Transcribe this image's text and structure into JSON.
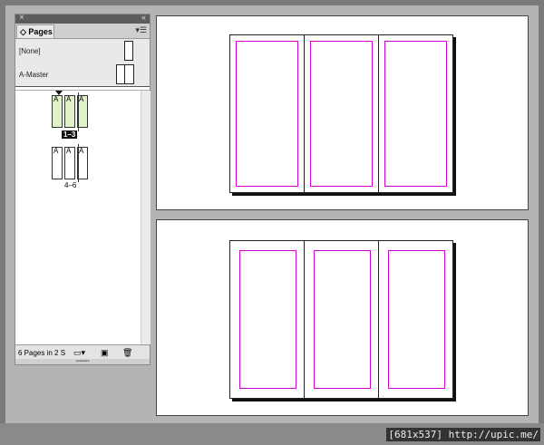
{
  "panel": {
    "close_glyph": "×",
    "collapse_glyph": "«",
    "tab_title": "Pages",
    "menu_glyph": "▾☰",
    "masters": [
      {
        "label": "[None]"
      },
      {
        "label": "A-Master"
      }
    ],
    "spreads": [
      {
        "label": "1–3",
        "pages": [
          "A",
          "A",
          "A"
        ],
        "selected": true
      },
      {
        "label": "4–6",
        "pages": [
          "A",
          "A",
          "A"
        ],
        "selected": false
      }
    ],
    "status_text": "6 Pages in 2 S",
    "status_icons": [
      "new-page-size-icon",
      "new-page-icon",
      "trash-icon"
    ]
  },
  "credit": "[681x537] http://upic.me/",
  "colors": {
    "margin_guide": "#d400d4",
    "selected_spread": "#dff3c6"
  }
}
